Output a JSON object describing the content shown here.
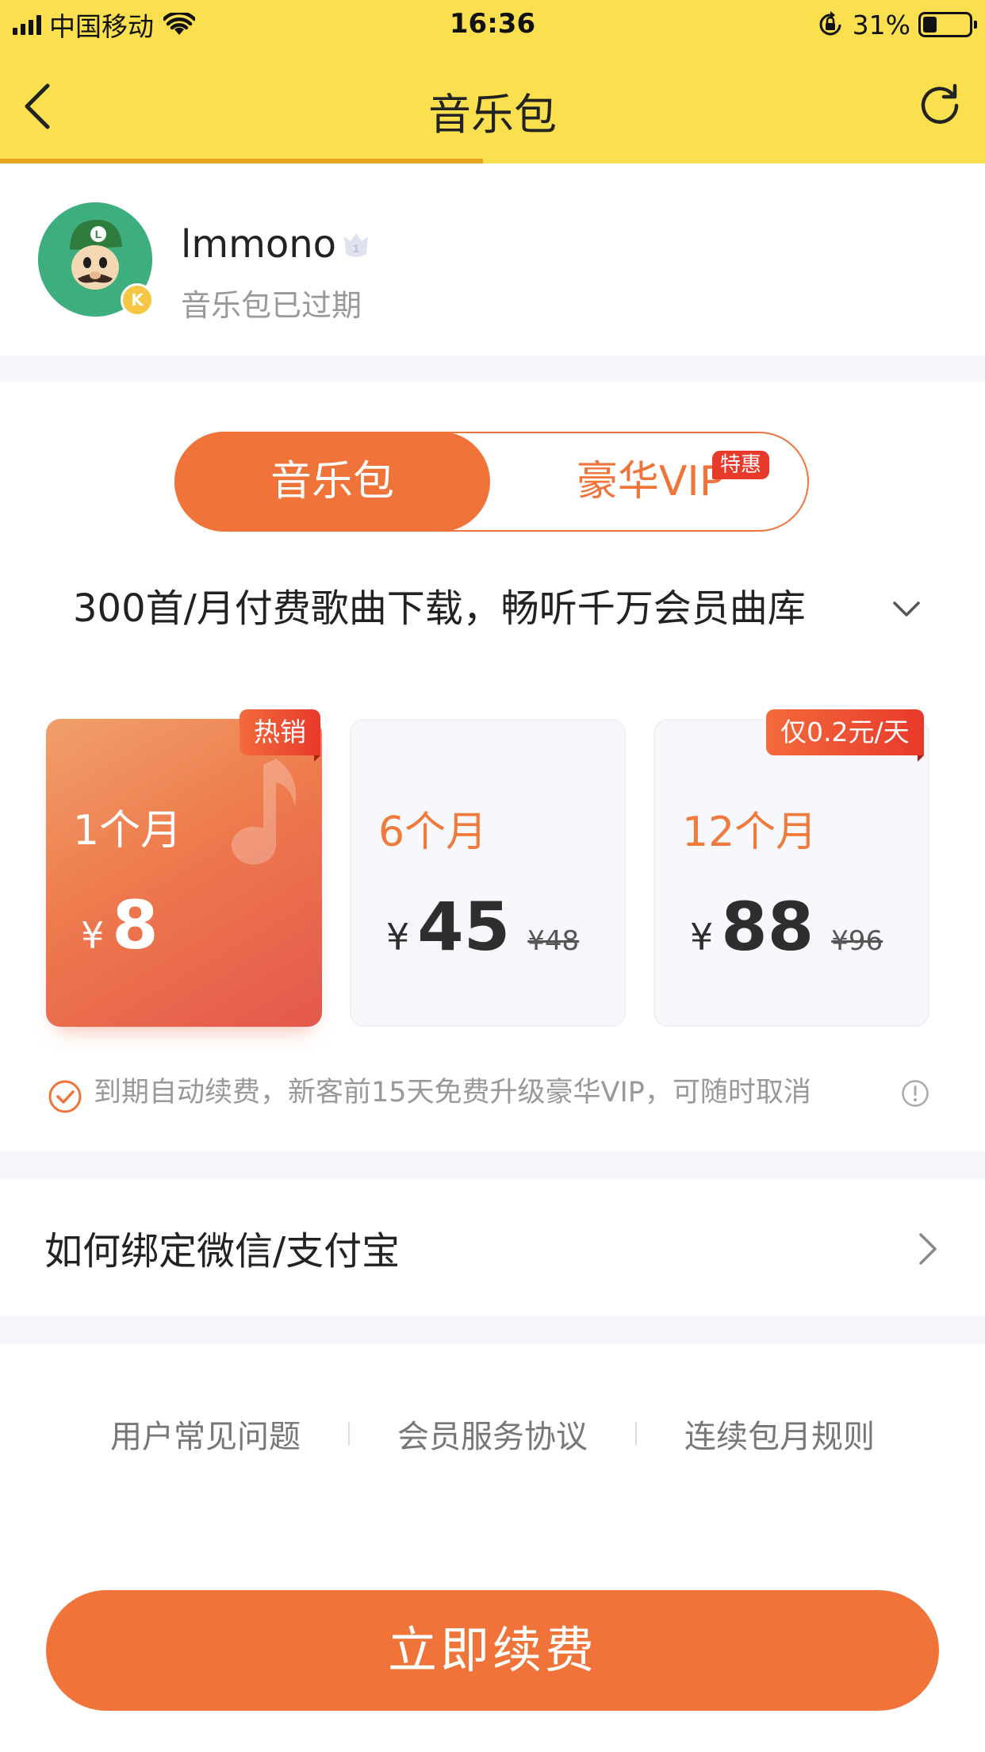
{
  "status_bar": {
    "carrier": "中国移动",
    "time": "16:36",
    "battery": "31%",
    "battery_level": 0.31
  },
  "nav": {
    "title": "音乐包",
    "back_icon": "chevron-left-icon",
    "refresh_icon": "refresh-icon",
    "page_load_progress": 0.49
  },
  "profile": {
    "username": "lmmono",
    "status": "音乐包已过期",
    "avatar_icon": "avatar-image",
    "badge_icon": "k-badge-icon",
    "level_icon": "crown-shield-icon"
  },
  "tabs": {
    "active": "音乐包",
    "inactive": "豪华VIP",
    "inactive_tag": "特惠"
  },
  "description": "300首/月付费歌曲下载，畅听千万会员曲库",
  "plans": [
    {
      "period": "1个月",
      "currency": "¥",
      "price": "8",
      "original": "",
      "tag": "热销",
      "selected": true
    },
    {
      "period": "6个月",
      "currency": "¥",
      "price": "45",
      "original": "¥48",
      "tag": "",
      "selected": false
    },
    {
      "period": "12个月",
      "currency": "¥",
      "price": "88",
      "original": "¥96",
      "tag": "仅0.2元/天",
      "selected": false
    }
  ],
  "auto_renew": {
    "text": "到期自动续费，新客前15天免费升级豪华VIP，可随时取消",
    "checked": true
  },
  "bind_row": {
    "label": "如何绑定微信/支付宝"
  },
  "footer_links": [
    "用户常见问题",
    "会员服务协议",
    "连续包月规则"
  ],
  "cta": {
    "label": "立即续费"
  },
  "colors": {
    "header_bg": "#fae04f",
    "accent": "#f0743a",
    "tag_red": "#e8392b",
    "progress": "#e8a51c",
    "muted_text": "#999999"
  }
}
